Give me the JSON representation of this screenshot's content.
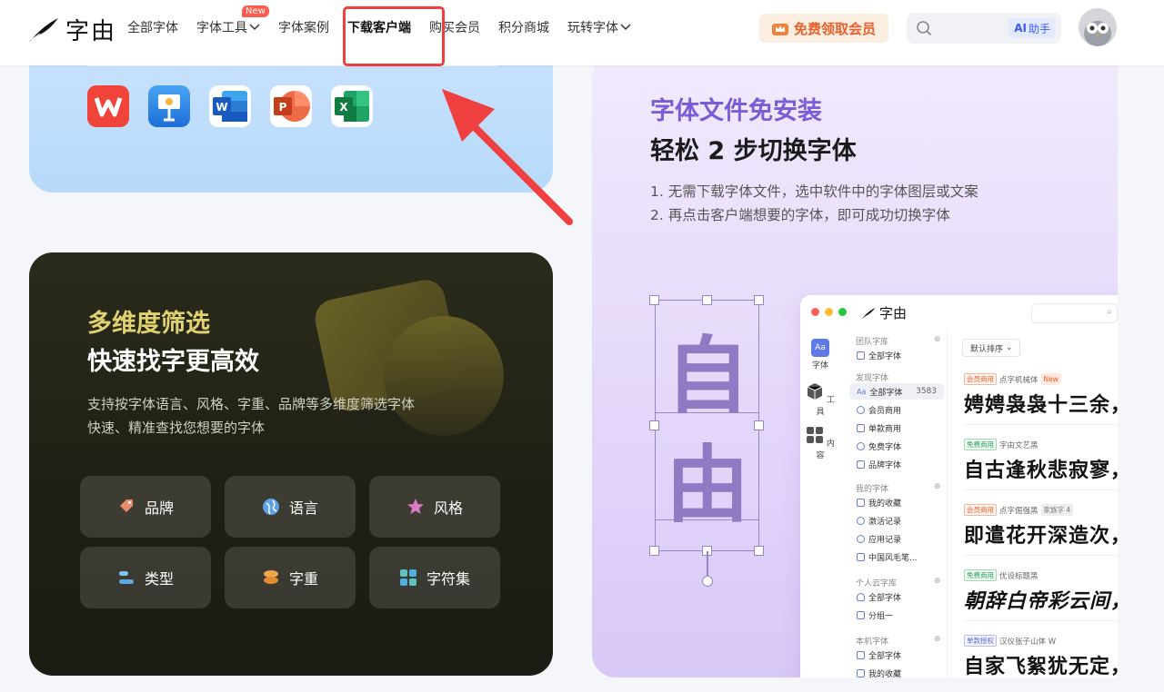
{
  "header": {
    "logo_text": "字由",
    "nav": [
      {
        "label": "全部字体"
      },
      {
        "label": "字体工具",
        "badge": "New",
        "dropdown": true
      },
      {
        "label": "字体案例"
      },
      {
        "label": "下载客户端",
        "active": true
      },
      {
        "label": "购买会员"
      },
      {
        "label": "积分商城"
      },
      {
        "label": "玩转字体",
        "dropdown": true
      }
    ],
    "vip_button": "免费领取会员",
    "ai_button": {
      "prefix": "AI",
      "label": "助手"
    },
    "highlight_color": "#ef3f3f"
  },
  "office_apps": [
    "wps-icon",
    "keynote-icon",
    "word-icon",
    "powerpoint-icon",
    "excel-icon"
  ],
  "filter_card": {
    "title_line1": "多维度筛选",
    "title_line2": "快速找字更高效",
    "desc_line1": "支持按字体语言、风格、字重、品牌等多维度筛选字体",
    "desc_line2": "快速、精准查找您想要的字体",
    "filters": [
      {
        "label": "品牌",
        "icon": "tag-icon",
        "color": "#e88a6c"
      },
      {
        "label": "语言",
        "icon": "globe-icon",
        "color": "#5fa1e6"
      },
      {
        "label": "风格",
        "icon": "star-icon",
        "color": "#d97bc5"
      },
      {
        "label": "类型",
        "icon": "list-icon",
        "color": "#7fc3f0"
      },
      {
        "label": "字重",
        "icon": "stack-icon",
        "color": "#f0a84e"
      },
      {
        "label": "字符集",
        "icon": "grid-icon",
        "color": "#5cc3c0"
      }
    ]
  },
  "switch_card": {
    "title_line1": "字体文件免安装",
    "title_line2": "轻松 2 步切换字体",
    "step1": "1. 无需下载字体文件，选中软件中的字体图层或文案",
    "step2": "2. 再点击客户端想要的字体，即可成功切换字体",
    "big_chars": [
      "自",
      "由"
    ]
  },
  "client_app": {
    "logo": "字由",
    "rail": [
      "字体",
      "工具",
      "内容"
    ],
    "sections": {
      "team": "团队字库",
      "discover": "发现字体",
      "mine": "我的字体",
      "cloud": "个人云字库",
      "local": "本机字体"
    },
    "items": {
      "team_all": "全部字体",
      "all": "全部字体",
      "all_count": "3583",
      "vip": "会员商用",
      "single": "单款商用",
      "free": "免费字体",
      "brand": "品牌字体",
      "fav": "我的收藏",
      "activate": "激活记录",
      "apply": "应用记录",
      "brush": "中国风毛笔...",
      "cloud_all": "全部字体",
      "group": "分组一",
      "local_all": "全部字体",
      "local_fav": "我的收藏"
    },
    "sort_label": "默认排序",
    "fonts": [
      {
        "tag": "会员商用",
        "tag_type": "vip",
        "name": "点字机械体",
        "extra": "New",
        "sample": "娉娉袅袅十三余，"
      },
      {
        "tag": "免费商用",
        "tag_type": "free",
        "name": "字由文艺黑",
        "extra": "",
        "sample": "自古逢秋悲寂寥，"
      },
      {
        "tag": "会员商用",
        "tag_type": "vip",
        "name": "点字倔强黑",
        "extra": "家族字 4",
        "sample": "即遣花开深造次，"
      },
      {
        "tag": "免费商用",
        "tag_type": "free",
        "name": "优设标题黑",
        "extra": "",
        "sample": "朝辞白帝彩云间，"
      },
      {
        "tag": "单款授权",
        "tag_type": "single",
        "name": "汉仪张子山体 W",
        "extra": "",
        "sample": "自家飞絮犹无定，"
      }
    ]
  }
}
